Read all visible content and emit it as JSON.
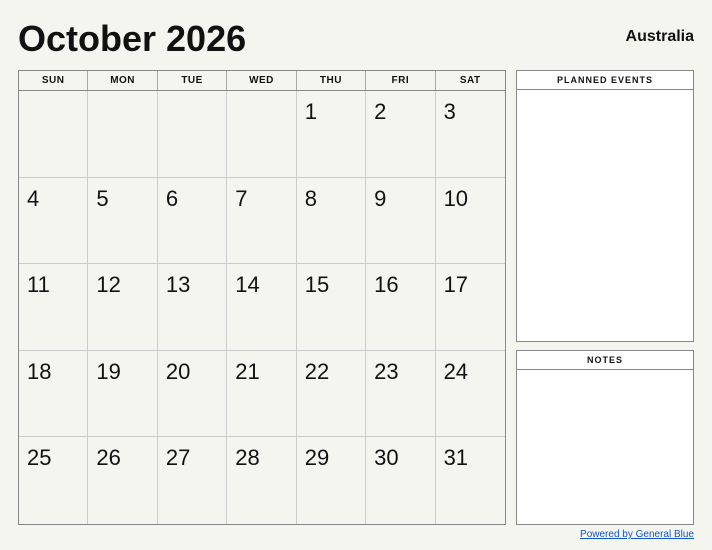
{
  "header": {
    "month_year": "October 2026",
    "country": "Australia"
  },
  "calendar": {
    "day_headers": [
      "SUN",
      "MON",
      "TUE",
      "WED",
      "THU",
      "FRI",
      "SAT"
    ],
    "days": [
      "",
      "",
      "",
      "",
      "1",
      "2",
      "3",
      "4",
      "5",
      "6",
      "7",
      "8",
      "9",
      "10",
      "11",
      "12",
      "13",
      "14",
      "15",
      "16",
      "17",
      "18",
      "19",
      "20",
      "21",
      "22",
      "23",
      "24",
      "25",
      "26",
      "27",
      "28",
      "29",
      "30",
      "31"
    ]
  },
  "sidebar": {
    "planned_events_label": "PLANNED EVENTS",
    "notes_label": "NOTES"
  },
  "footer": {
    "link_text": "Powered by General Blue",
    "link_url": "#"
  }
}
